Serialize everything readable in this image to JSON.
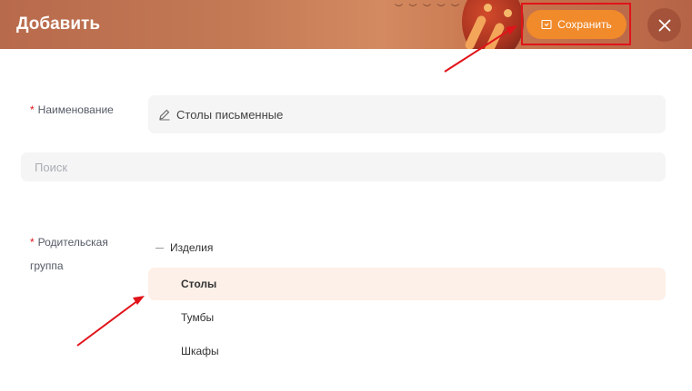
{
  "header": {
    "title": "Добавить",
    "save_label": "Сохранить",
    "accent_color": "#f08a2b"
  },
  "form": {
    "name": {
      "label": "Наименование",
      "required_mark": "*",
      "value": "Столы письменные",
      "icon": "pencil-icon"
    },
    "search": {
      "placeholder": "Поиск"
    },
    "parent_group": {
      "label_line1": "Родительская",
      "label_line2": "группа",
      "required_mark": "*",
      "tree": {
        "root": "Изделия",
        "items": [
          {
            "label": "Столы",
            "selected": true
          },
          {
            "label": "Тумбы",
            "selected": false
          },
          {
            "label": "Шкафы",
            "selected": false
          }
        ]
      }
    }
  },
  "annotations": {
    "color": "#e0141a"
  }
}
